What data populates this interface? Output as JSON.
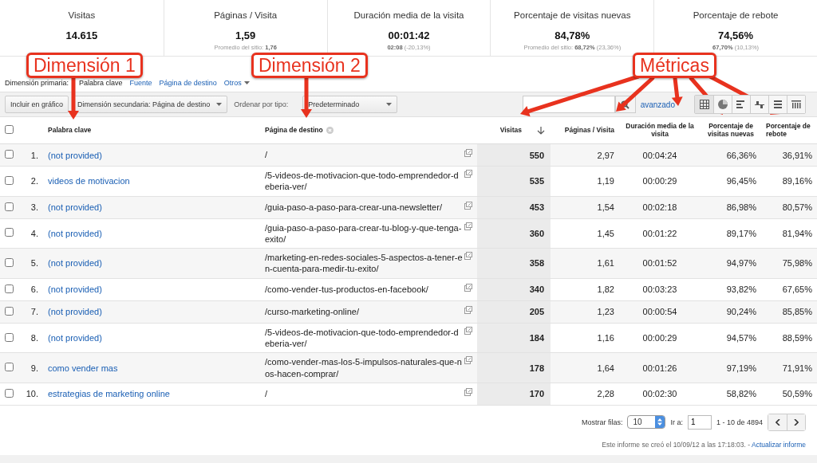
{
  "metrics": [
    {
      "label": "Visitas",
      "value": "14.615"
    },
    {
      "label": "Páginas / Visita",
      "value": "1,59",
      "site_avg": "Promedio del sitio: **1,76**"
    },
    {
      "label": "Duración media de la visita",
      "value": "00:01:42",
      "site_avg": "**02:08** (-20,13%)"
    },
    {
      "label": "Porcentaje de visitas nuevas",
      "value": "84,78%",
      "site_avg": "Promedio del sitio: **68,72%** (23,36%)"
    },
    {
      "label": "Porcentaje de rebote",
      "value": "74,56%",
      "site_avg": "**67,70%** (10,13%)"
    }
  ],
  "annotations": [
    {
      "text": "Dimensión 1"
    },
    {
      "text": "Dimensión 2"
    },
    {
      "text": "Métricas"
    }
  ],
  "primary_dimension": {
    "label": "Dimensión primaria:",
    "options": [
      {
        "label": "Palabra clave",
        "selected": true
      },
      {
        "label": "Fuente",
        "selected": false
      },
      {
        "label": "Página de destino",
        "selected": false
      },
      {
        "label": "Otros",
        "selected": false
      }
    ]
  },
  "toolbar": {
    "plot_button": "Incluir en gráfico",
    "secondary_dimension": "Dimensión secundaria: Página de destino",
    "sort_label": "Ordenar por tipo:",
    "sort_value": "Predeterminado",
    "advanced_link": "avanzado"
  },
  "table": {
    "select_all_checked": false,
    "columns": [
      "Palabra clave",
      "Página de destino",
      "Visitas",
      "Páginas / Visita",
      "Duración media de la visita",
      "Porcentaje de visitas nuevas",
      "Porcentaje de rebote"
    ],
    "rows": [
      {
        "index": "1.",
        "keyword": "(not provided)",
        "page": "/",
        "visits": "550",
        "pages_per_visit": "2,97",
        "duration": "00:04:24",
        "new_visits": "66,36%",
        "bounce": "36,91%",
        "checked": false
      },
      {
        "index": "2.",
        "keyword": "videos de motivacion",
        "page": "/5-videos-de-motivacion-que-todo-emprendedor-deberia-ver/",
        "visits": "535",
        "pages_per_visit": "1,19",
        "duration": "00:00:29",
        "new_visits": "96,45%",
        "bounce": "89,16%",
        "checked": false
      },
      {
        "index": "3.",
        "keyword": "(not provided)",
        "page": "/guia-paso-a-paso-para-crear-una-newsletter/",
        "visits": "453",
        "pages_per_visit": "1,54",
        "duration": "00:02:18",
        "new_visits": "86,98%",
        "bounce": "80,57%",
        "checked": false
      },
      {
        "index": "4.",
        "keyword": "(not provided)",
        "page": "/guia-paso-a-paso-para-crear-tu-blog-y-que-tenga-exito/",
        "visits": "360",
        "pages_per_visit": "1,45",
        "duration": "00:01:22",
        "new_visits": "89,17%",
        "bounce": "81,94%",
        "checked": false
      },
      {
        "index": "5.",
        "keyword": "(not provided)",
        "page": "/marketing-en-redes-sociales-5-aspectos-a-tener-en-cuenta-para-medir-tu-exito/",
        "visits": "358",
        "pages_per_visit": "1,61",
        "duration": "00:01:52",
        "new_visits": "94,97%",
        "bounce": "75,98%",
        "checked": false
      },
      {
        "index": "6.",
        "keyword": "(not provided)",
        "page": "/como-vender-tus-productos-en-facebook/",
        "visits": "340",
        "pages_per_visit": "1,82",
        "duration": "00:03:23",
        "new_visits": "93,82%",
        "bounce": "67,65%",
        "checked": false
      },
      {
        "index": "7.",
        "keyword": "(not provided)",
        "page": "/curso-marketing-online/",
        "visits": "205",
        "pages_per_visit": "1,23",
        "duration": "00:00:54",
        "new_visits": "90,24%",
        "bounce": "85,85%",
        "checked": false
      },
      {
        "index": "8.",
        "keyword": "(not provided)",
        "page": "/5-videos-de-motivacion-que-todo-emprendedor-deberia-ver/",
        "visits": "184",
        "pages_per_visit": "1,16",
        "duration": "00:00:29",
        "new_visits": "94,57%",
        "bounce": "88,59%",
        "checked": false
      },
      {
        "index": "9.",
        "keyword": "como vender mas",
        "page": "/como-vender-mas-los-5-impulsos-naturales-que-nos-hacen-comprar/",
        "visits": "178",
        "pages_per_visit": "1,64",
        "duration": "00:01:26",
        "new_visits": "97,19%",
        "bounce": "71,91%",
        "checked": false
      },
      {
        "index": "10.",
        "keyword": "estrategias de marketing online",
        "page": "/",
        "visits": "170",
        "pages_per_visit": "2,28",
        "duration": "00:02:30",
        "new_visits": "58,82%",
        "bounce": "50,59%",
        "checked": false
      }
    ]
  },
  "pagination": {
    "rows_label": "Mostrar filas:",
    "rows_value": "10",
    "goto_label": "Ir a:",
    "goto_value": "1",
    "range": "1 - 10 de 4894"
  },
  "report_note": {
    "text": "Este informe se creó el 10/09/12 a las 17:18:03. -",
    "link": "Actualizar informe"
  }
}
